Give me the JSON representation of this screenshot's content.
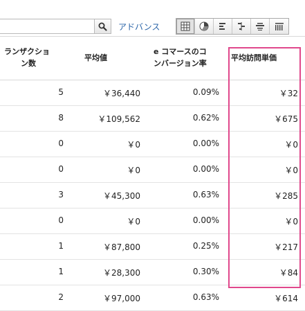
{
  "toolbar": {
    "search": {
      "value": "",
      "placeholder": ""
    },
    "search_icon": "magnifier-icon",
    "advanced_label": "アドバンス",
    "views": [
      {
        "name": "table-view",
        "active": true
      },
      {
        "name": "pie-view",
        "active": false
      },
      {
        "name": "bar-view",
        "active": false
      },
      {
        "name": "comparison-view",
        "active": false
      },
      {
        "name": "term-cloud-view",
        "active": false
      },
      {
        "name": "pivot-view",
        "active": false
      }
    ]
  },
  "table": {
    "headers": [
      [
        "ランザクショ",
        "ン数"
      ],
      [
        "平均値"
      ],
      [
        "e コマースのコ",
        "ンバージョン率"
      ],
      [
        "平均訪問単価"
      ]
    ],
    "rows": [
      [
        "5",
        "￥36,440",
        "0.09%",
        "￥32"
      ],
      [
        "8",
        "￥109,562",
        "0.62%",
        "￥675"
      ],
      [
        "0",
        "￥0",
        "0.00%",
        "￥0"
      ],
      [
        "0",
        "￥0",
        "0.00%",
        "￥0"
      ],
      [
        "3",
        "￥45,300",
        "0.63%",
        "￥285"
      ],
      [
        "0",
        "￥0",
        "0.00%",
        "￥0"
      ],
      [
        "1",
        "￥87,800",
        "0.25%",
        "￥217"
      ],
      [
        "1",
        "￥28,300",
        "0.30%",
        "￥84"
      ],
      [
        "2",
        "￥97,000",
        "0.63%",
        "￥614"
      ]
    ]
  },
  "colors": {
    "highlight": "#e0488c",
    "link": "#2a64a8"
  }
}
